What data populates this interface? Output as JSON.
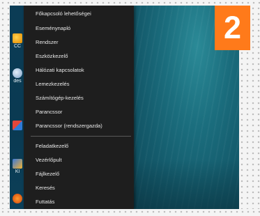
{
  "step_badge": {
    "number": "2",
    "color": "#ff7a1a"
  },
  "desktop": {
    "icons": [
      {
        "label": "CC",
        "icon": "app-icon"
      },
      {
        "label": "des",
        "icon": "settings-icon"
      },
      {
        "label": "",
        "icon": "app-icon"
      },
      {
        "label": "Kl",
        "icon": "app-icon"
      },
      {
        "label": "",
        "icon": "firefox-icon"
      }
    ]
  },
  "menu": {
    "items": [
      {
        "label": "Főkapcsoló lehetőségei"
      },
      {
        "label": "Eseménynapló"
      },
      {
        "label": "Rendszer"
      },
      {
        "label": "Eszközkezelő"
      },
      {
        "label": "Hálózati kapcsolatok"
      },
      {
        "label": "Lemezkezelés"
      },
      {
        "label": "Számítógép-kezelés"
      },
      {
        "label": "Parancssor"
      },
      {
        "label": "Parancssor (rendszergazda)"
      },
      {
        "label": "Feladatkezelő"
      },
      {
        "label": "Vezérlőpult"
      },
      {
        "label": "Fájlkezelő"
      },
      {
        "label": "Keresés"
      },
      {
        "label": "Futtatás"
      }
    ]
  }
}
